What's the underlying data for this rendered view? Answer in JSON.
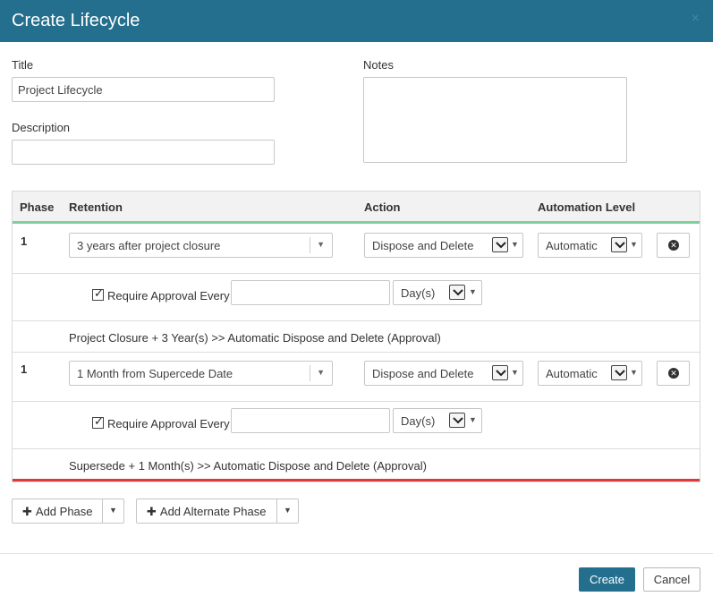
{
  "dialog": {
    "title": "Create Lifecycle",
    "close_glyph": "×"
  },
  "form": {
    "title_label": "Title",
    "title_value": "Project Lifecycle",
    "description_label": "Description",
    "description_value": "",
    "notes_label": "Notes",
    "notes_value": ""
  },
  "table": {
    "headers": {
      "phase": "Phase",
      "retention": "Retention",
      "action": "Action",
      "automation": "Automation Level"
    },
    "phases": [
      {
        "phase": "1",
        "retention": "3 years after project closure",
        "action": "Dispose and Delete",
        "automation": "Automatic",
        "approval_checked": true,
        "approval_label": "Require Approval Every",
        "approval_value": "",
        "unit": "Day(s)",
        "summary": "Project Closure + 3 Year(s) >> Automatic Dispose and Delete (Approval)"
      },
      {
        "phase": "1",
        "retention": "1 Month from Supercede Date",
        "action": "Dispose and Delete",
        "automation": "Automatic",
        "approval_checked": true,
        "approval_label": "Require Approval Every",
        "approval_value": "",
        "unit": "Day(s)",
        "summary": "Supersede + 1 Month(s) >> Automatic Dispose and Delete (Approval)"
      }
    ]
  },
  "buttons": {
    "add_phase": "Add Phase",
    "add_alternate_phase": "Add Alternate Phase",
    "create": "Create",
    "cancel": "Cancel"
  },
  "colors": {
    "header_bg": "#246f8e",
    "primary_button": "#246f8e",
    "header_rule_green": "#7fcf9c",
    "bottom_rule_red": "#dc3a3a"
  },
  "icons": [
    "close-icon",
    "caret-down-icon",
    "chevron-down-icon",
    "remove-circle-icon",
    "checkbox-icon",
    "plus-icon"
  ]
}
